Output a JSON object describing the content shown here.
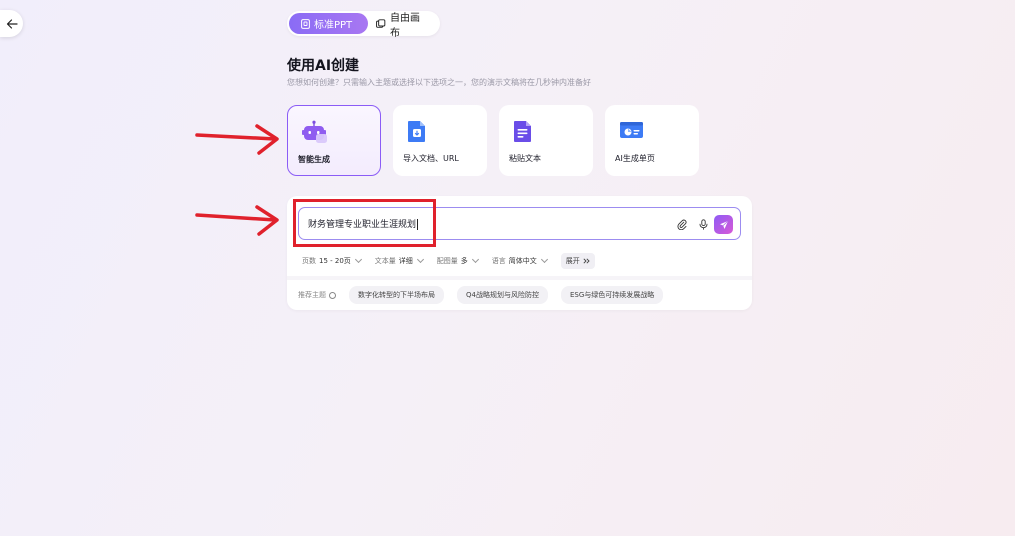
{
  "mode_switch": {
    "tabs": [
      {
        "label": "标准PPT",
        "active": true
      },
      {
        "label": "自由画布",
        "active": false
      }
    ]
  },
  "create": {
    "title": "使用AI创建",
    "subtitle": "您想如何创建？只需输入主题或选择以下选项之一，您的演示文稿将在几秒钟内准备好"
  },
  "options": [
    {
      "label": "智能生成",
      "icon": "robot-icon",
      "selected": true
    },
    {
      "label": "导入文档、URL",
      "icon": "import-doc-icon",
      "selected": false
    },
    {
      "label": "粘贴文本",
      "icon": "paste-text-icon",
      "selected": false
    },
    {
      "label": "AI生成单页",
      "icon": "single-slide-icon",
      "selected": false
    }
  ],
  "topic_input": {
    "value": "财务管理专业职业生涯规划"
  },
  "settings": [
    {
      "label": "页数",
      "value": "15 - 20页"
    },
    {
      "label": "文本量",
      "value": "详细"
    },
    {
      "label": "配图量",
      "value": "多"
    },
    {
      "label": "语言",
      "value": "简体中文"
    }
  ],
  "expand_label": "展开",
  "recommended": {
    "label": "推荐主题",
    "topics": [
      "数字化转型的下半场布局",
      "Q4战略规划与风险防控",
      "ESG与绿色可持续发展战略"
    ]
  },
  "colors": {
    "accent": "#8b5cf6",
    "annotation": "#e0212c"
  }
}
